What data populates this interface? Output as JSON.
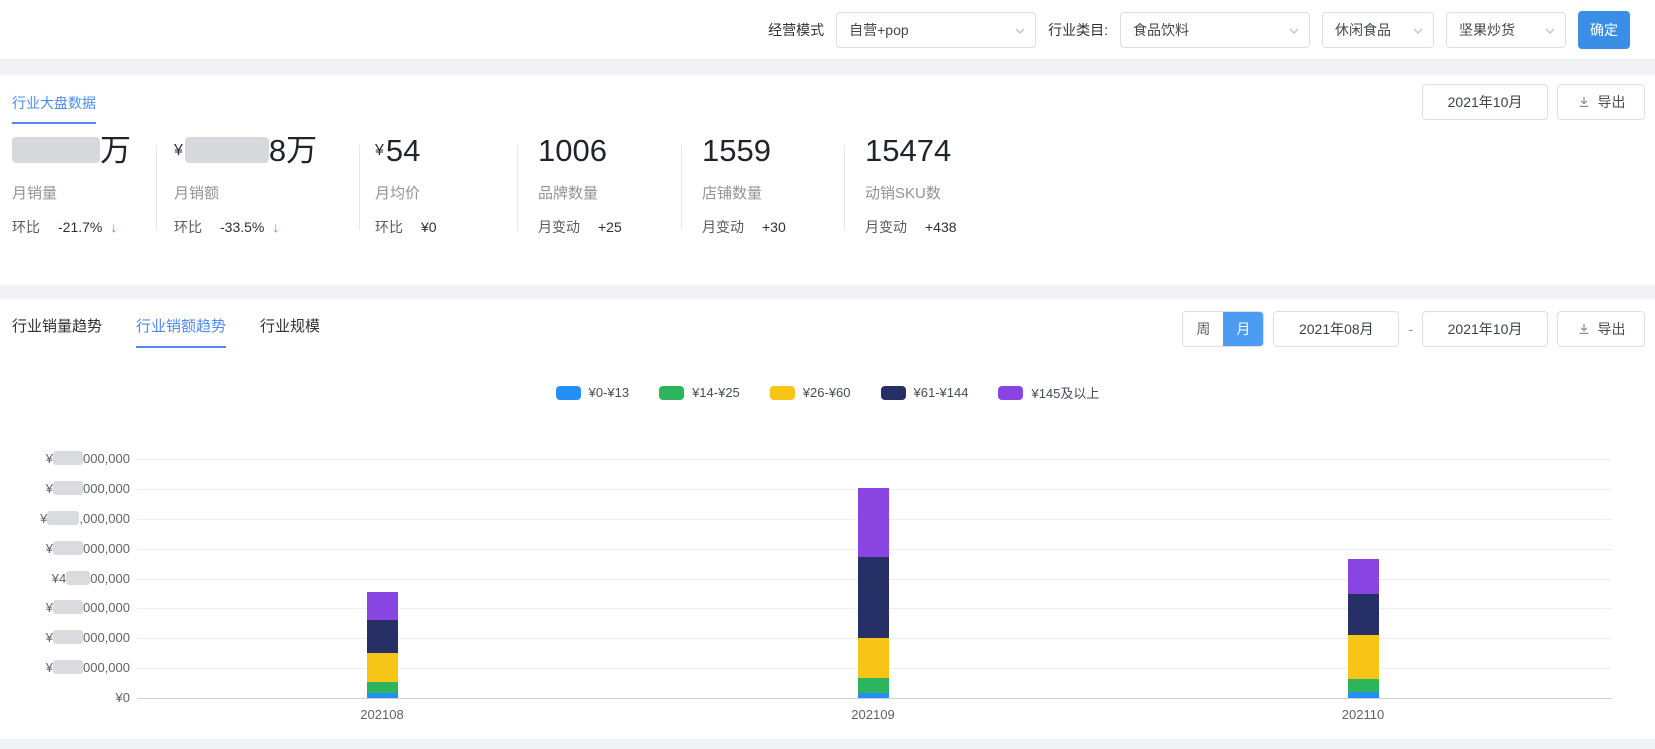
{
  "colors": {
    "accent_button": "#3a8ee6",
    "toggle_selected": "#4d9cf3",
    "active_tab_link": "#4e8bf0",
    "down_arrow_green": "#3cb371"
  },
  "filters": {
    "mode_label": "经营模式",
    "mode_value": "自营+pop",
    "category_label": "行业类目:",
    "category_l1": "食品饮料",
    "category_l2": "休闲食品",
    "category_l3": "坚果炒货",
    "confirm_label": "确定"
  },
  "overview": {
    "tab_label": "行业大盘数据",
    "month_selector": "2021年10月",
    "export_label": "导出",
    "stats": [
      {
        "value_suffix": "万",
        "label": "月销量",
        "sub_label": "环比",
        "sub_value": "-21.7%",
        "arrow": "↓"
      },
      {
        "value_prefix": "¥",
        "value_suffix": "8万",
        "label": "月销额",
        "sub_label": "环比",
        "sub_value": "-33.5%",
        "arrow": "↓"
      },
      {
        "value_prefix": "¥",
        "value": "54",
        "label": "月均价",
        "sub_label": "环比",
        "sub_value": "¥0"
      },
      {
        "value": "1006",
        "label": "品牌数量",
        "sub_label": "月变动",
        "sub_value": "+25"
      },
      {
        "value": "1559",
        "label": "店铺数量",
        "sub_label": "月变动",
        "sub_value": "+30"
      },
      {
        "value": "15474",
        "label": "动销SKU数",
        "sub_label": "月变动",
        "sub_value": "+438"
      }
    ]
  },
  "trend": {
    "tabs": [
      {
        "label": "行业销量趋势",
        "active": false
      },
      {
        "label": "行业销额趋势",
        "active": true
      },
      {
        "label": "行业规模",
        "active": false
      }
    ],
    "period_toggle": {
      "options": [
        "周",
        "月"
      ],
      "selected": "月"
    },
    "date_from": "2021年08月",
    "date_separator": "-",
    "date_to": "2021年10月",
    "export_label": "导出"
  },
  "chart_data": {
    "type": "bar",
    "stacked": true,
    "title": "行业销额趋势 (月)",
    "categories": [
      "202108",
      "202109",
      "202110"
    ],
    "series": [
      {
        "name": "¥0-¥13",
        "color": "#2490f5",
        "values": [
          170000,
          170000,
          200000
        ]
      },
      {
        "name": "¥14-¥25",
        "color": "#2db55d",
        "values": [
          370000,
          500000,
          450000
        ]
      },
      {
        "name": "¥26-¥60",
        "color": "#f7c515",
        "values": [
          970000,
          1350000,
          1450000
        ]
      },
      {
        "name": "¥61-¥144",
        "color": "#272f67",
        "values": [
          1100000,
          2700000,
          1400000
        ]
      },
      {
        "name": "¥145及以上",
        "color": "#8945e2",
        "values": [
          940000,
          2300000,
          1150000
        ]
      }
    ],
    "ylim": [
      0,
      8000000
    ],
    "y_tick_interval": 1000000,
    "grid": true,
    "legend_position": "top-center",
    "y_axis_labels": [
      {
        "value": 0,
        "pre": "¥0",
        "blob": 0,
        "suf": ""
      },
      {
        "value": 1000000,
        "pre": "¥",
        "blob": 30,
        "suf": "000,000"
      },
      {
        "value": 2000000,
        "pre": "¥",
        "blob": 30,
        "suf": "000,000"
      },
      {
        "value": 3000000,
        "pre": "¥",
        "blob": 30,
        "suf": "000,000"
      },
      {
        "value": 4000000,
        "pre": "¥4",
        "blob": 24,
        "suf": "00,000"
      },
      {
        "value": 5000000,
        "pre": "¥",
        "blob": 30,
        "suf": "000,000"
      },
      {
        "value": 6000000,
        "pre": "¥",
        "blob": 32,
        "suf": ",000,000"
      },
      {
        "value": 7000000,
        "pre": "¥",
        "blob": 30,
        "suf": "000,000"
      },
      {
        "value": 8000000,
        "pre": "¥",
        "blob": 30,
        "suf": "000,000"
      }
    ]
  }
}
